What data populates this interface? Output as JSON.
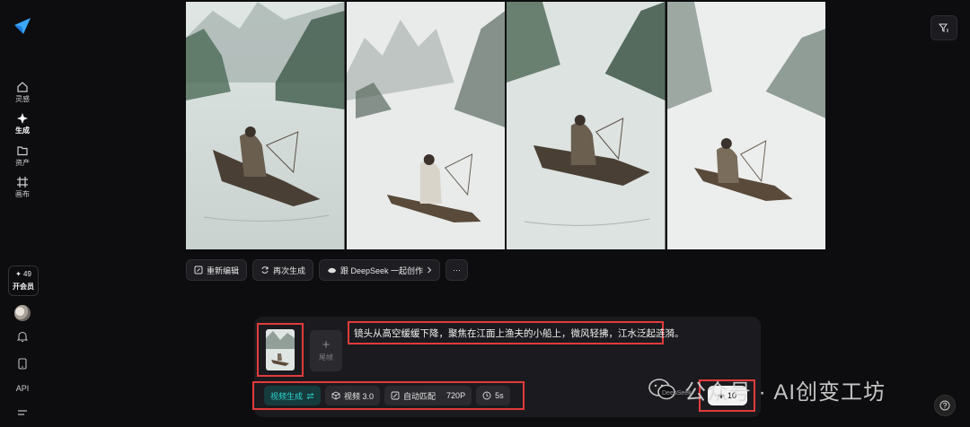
{
  "sidebar": {
    "nav": [
      {
        "label": "灵感",
        "icon": "home-icon"
      },
      {
        "label": "生成",
        "icon": "sparkle-icon"
      },
      {
        "label": "资产",
        "icon": "folder-icon"
      },
      {
        "label": "画布",
        "icon": "canvas-icon"
      }
    ],
    "credits": "✦ 49",
    "vip_label": "开会员",
    "api_label": "API"
  },
  "actions": {
    "reedit": "重新编辑",
    "regenerate": "再次生成",
    "deepseek": "跟 DeepSeek 一起创作",
    "more": "···"
  },
  "composer": {
    "tail_frame_label": "尾帧",
    "prompt": "镜头从高空缓缓下降，聚焦在江面上渔夫的小船上，微风轻拂，江水泛起涟漪。",
    "mode": "视频生成",
    "model": "视频 3.0",
    "ratio": "自动匹配",
    "resolution": "720P",
    "duration": "5s",
    "submit_cost": "10"
  },
  "watermark": {
    "text": "公众号 · AI创变工坊",
    "sub": "DeepSeek"
  },
  "colors": {
    "background": "#0d0d0f",
    "accent": "#2fd4cf",
    "highlight_box": "#e23b3b"
  }
}
